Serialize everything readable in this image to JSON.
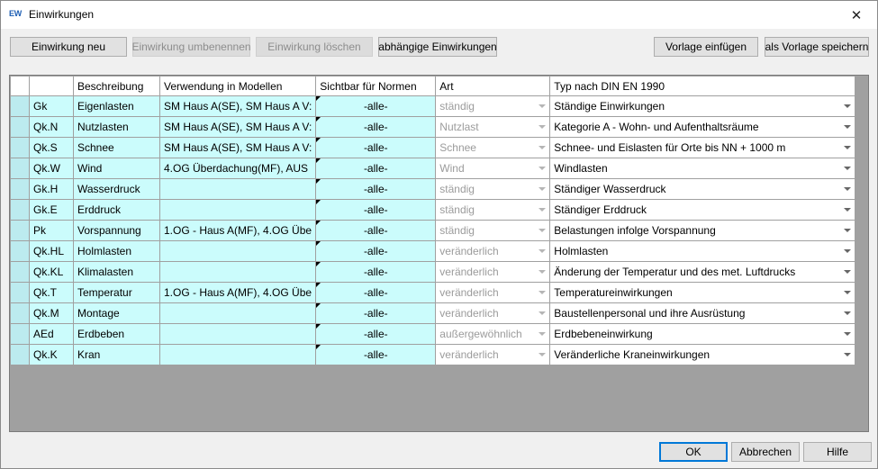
{
  "window": {
    "icon_text": "EW",
    "title": "Einwirkungen",
    "close_glyph": "✕"
  },
  "toolbar": {
    "new_label": "Einwirkung neu",
    "rename_label": "Einwirkung umbenennen",
    "delete_label": "Einwirkung löschen",
    "dependent_label": "abhängige Einwirkungen",
    "insert_template_label": "Vorlage einfügen",
    "save_template_label": "als Vorlage speichern"
  },
  "grid": {
    "columns": [
      "",
      "",
      "Beschreibung",
      "Verwendung in Modellen",
      "Sichtbar für Normen",
      "Art",
      "Typ nach DIN EN 1990"
    ],
    "rows": [
      {
        "code": "Gk",
        "desc": "Eigenlasten",
        "usage": "SM Haus A(SE), SM Haus A V:",
        "norm": "-alle-",
        "art": "ständig",
        "typ": "Ständige Einwirkungen"
      },
      {
        "code": "Qk.N",
        "desc": "Nutzlasten",
        "usage": "SM Haus A(SE), SM Haus A V:",
        "norm": "-alle-",
        "art": "Nutzlast",
        "typ": "Kategorie A - Wohn- und Aufenthaltsräume"
      },
      {
        "code": "Qk.S",
        "desc": "Schnee",
        "usage": "SM Haus A(SE), SM Haus A V:",
        "norm": "-alle-",
        "art": "Schnee",
        "typ": "Schnee- und Eislasten für Orte bis NN + 1000 m"
      },
      {
        "code": "Qk.W",
        "desc": "Wind",
        "usage": "4.OG Überdachung(MF), AUS",
        "norm": "-alle-",
        "art": "Wind",
        "typ": "Windlasten"
      },
      {
        "code": "Gk.H",
        "desc": "Wasserdruck",
        "usage": "",
        "norm": "-alle-",
        "art": "ständig",
        "typ": "Ständiger Wasserdruck"
      },
      {
        "code": "Gk.E",
        "desc": "Erddruck",
        "usage": "",
        "norm": "-alle-",
        "art": "ständig",
        "typ": "Ständiger Erddruck"
      },
      {
        "code": "Pk",
        "desc": "Vorspannung",
        "usage": "1.OG - Haus A(MF), 4.OG Übe",
        "norm": "-alle-",
        "art": "ständig",
        "typ": "Belastungen infolge Vorspannung"
      },
      {
        "code": "Qk.HL",
        "desc": "Holmlasten",
        "usage": "",
        "norm": "-alle-",
        "art": "veränderlich",
        "typ": "Holmlasten"
      },
      {
        "code": "Qk.KL",
        "desc": "Klimalasten",
        "usage": "",
        "norm": "-alle-",
        "art": "veränderlich",
        "typ": "Änderung der Temperatur und des met. Luftdrucks"
      },
      {
        "code": "Qk.T",
        "desc": "Temperatur",
        "usage": "1.OG - Haus A(MF), 4.OG Übe",
        "norm": "-alle-",
        "art": "veränderlich",
        "typ": "Temperatureinwirkungen"
      },
      {
        "code": "Qk.M",
        "desc": "Montage",
        "usage": "",
        "norm": "-alle-",
        "art": "veränderlich",
        "typ": "Baustellenpersonal und ihre Ausrüstung"
      },
      {
        "code": "AEd",
        "desc": "Erdbeben",
        "usage": "",
        "norm": "-alle-",
        "art": "außergewöhnlich",
        "typ": "Erdbebeneinwirkung"
      },
      {
        "code": "Qk.K",
        "desc": "Kran",
        "usage": "",
        "norm": "-alle-",
        "art": "veränderlich",
        "typ": "Veränderliche Kraneinwirkungen"
      }
    ]
  },
  "footer": {
    "ok_label": "OK",
    "cancel_label": "Abbrechen",
    "help_label": "Hilfe"
  },
  "colors": {
    "row_cell": "#cbfcfc",
    "selector": "#bcebef",
    "grid_bg": "#a0a0a0",
    "default_border": "#0078d7"
  }
}
